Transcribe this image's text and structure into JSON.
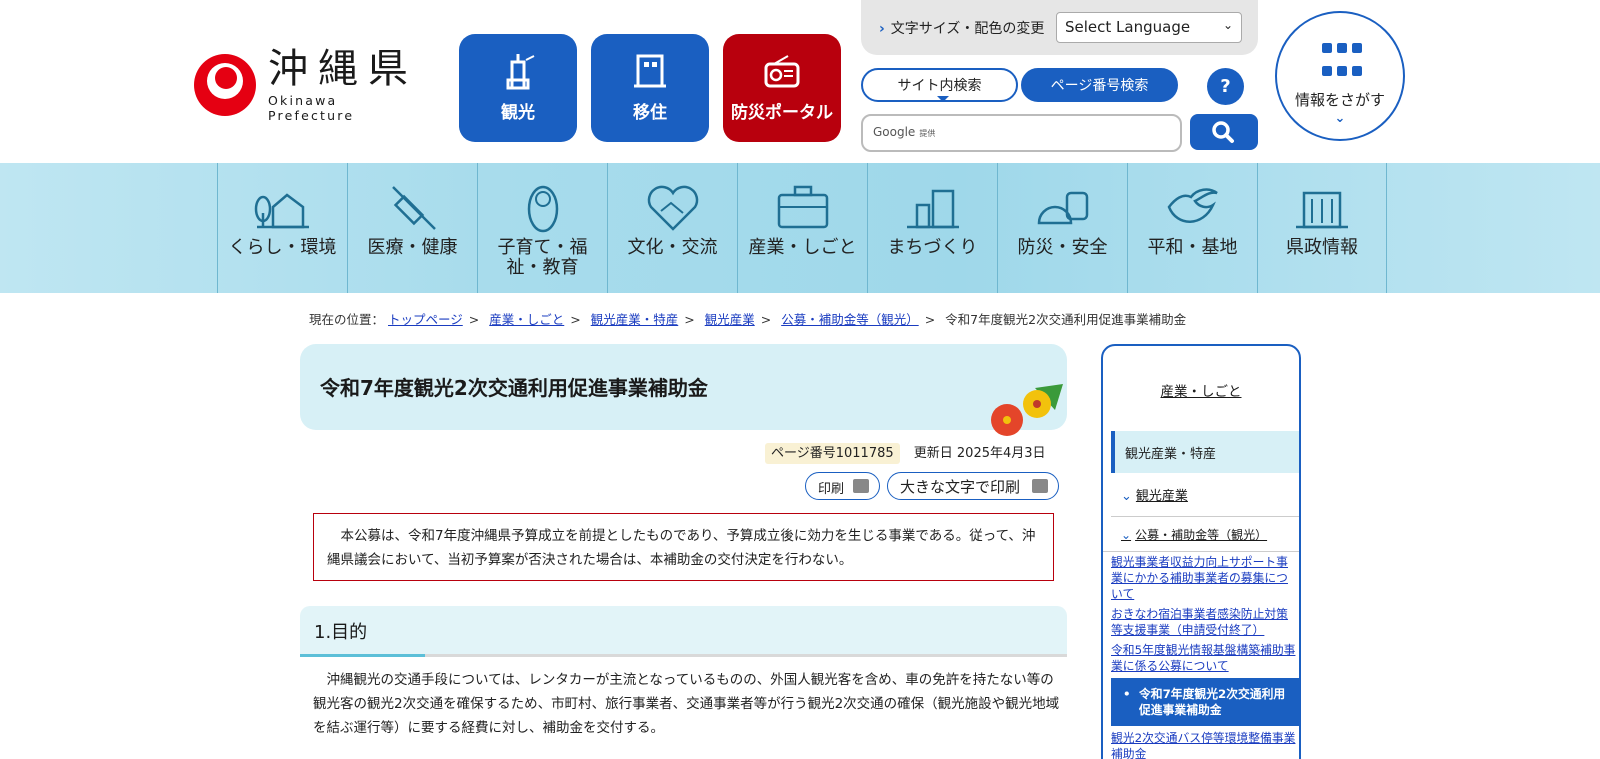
{
  "header": {
    "logo_ja": "沖縄県",
    "logo_en": "Okinawa Prefecture",
    "quick_links": [
      {
        "label": "観光"
      },
      {
        "label": "移住"
      },
      {
        "label": "防災ポータル"
      }
    ],
    "font_size_link": "文字サイズ・配色の変更",
    "language_select": "Select Language",
    "search_tabs": {
      "site": "サイト内検索",
      "page_number": "ページ番号検索"
    },
    "help_label": "?",
    "search": {
      "brand": "Google",
      "provided": "提供"
    },
    "info_search": "情報をさがす"
  },
  "global_nav": [
    {
      "label": "くらし・環境"
    },
    {
      "label": "医療・健康"
    },
    {
      "label": "子育て・福祉・教育"
    },
    {
      "label": "文化・交流"
    },
    {
      "label": "産業・しごと"
    },
    {
      "label": "まちづくり"
    },
    {
      "label": "防災・安全"
    },
    {
      "label": "平和・基地"
    },
    {
      "label": "県政情報"
    }
  ],
  "breadcrumb": {
    "prefix": "現在の位置：",
    "items": [
      "トップページ",
      "産業・しごと",
      "観光産業・特産",
      "観光産業",
      "公募・補助金等（観光）"
    ],
    "current": "令和7年度観光2次交通利用促進事業補助金"
  },
  "main": {
    "title": "令和7年度観光2次交通利用促進事業補助金",
    "page_number": "ページ番号1011785",
    "updated": "更新日 2025年4月3日",
    "print": "印刷",
    "print_large": "大きな文字で印刷",
    "notice": "　本公募は、令和7年度沖縄県予算成立を前提としたものであり、予算成立後に効力を生じる事業である。従って、沖縄県議会において、当初予算案が否決された場合は、本補助金の交付決定を行わない。",
    "section1_title": "1.目的",
    "section1_body": "　沖縄観光の交通手段については、レンタカーが主流となっているものの、外国人観光客を含め、車の免許を持たない等の観光客の観光2次交通を確保するため、市町村、旅行事業者、交通事業者等が行う観光2次交通の確保（観光施設や観光地域を結ぶ運行等）に要する経費に対し、補助金を交付する。"
  },
  "sidebar": {
    "top": "産業・しごと",
    "category": "観光産業・特産",
    "sub": "観光産業",
    "sub2": "公募・補助金等（観光）",
    "links": [
      "観光事業者収益力向上サポート事業にかかる補助事業者の募集について",
      "おきなわ宿泊事業者感染防止対策等支援事業（申請受付終了）",
      "令和5年度観光情報基盤構築補助事業に係る公募について"
    ],
    "current": "令和7年度観光2次交通利用促進事業補助金",
    "links_after": [
      "観光2次交通バス停等環境整備事業補助金"
    ]
  }
}
